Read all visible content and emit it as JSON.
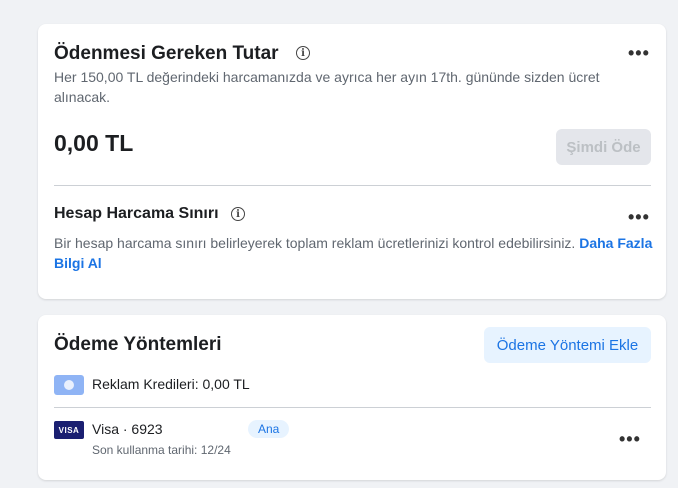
{
  "amount_due": {
    "title": "Ödenmesi Gereken Tutar",
    "description": "Her 150,00 TL değerindeki harcamanızda ve ayrıca her ayın 17th. gününde sizden ücret alınacak.",
    "amount": "0,00 TL",
    "pay_now_label": "Şimdi Öde"
  },
  "spending_limit": {
    "title": "Hesap Harcama Sınırı",
    "description": "Bir hesap harcama sınırı belirleyerek toplam reklam ücretlerinizi kontrol edebilirsiniz.",
    "learn_more": "Daha Fazla Bilgi Al"
  },
  "payment_methods": {
    "title": "Ödeme Yöntemleri",
    "add_label": "Ödeme Yöntemi Ekle",
    "ad_credits": "Reklam Kredileri: 0,00 TL",
    "card": {
      "brand_logo": "VISA",
      "name": "Visa · 6923",
      "badge": "Ana",
      "expiry": "Son kullanma tarihi: 12/24"
    }
  },
  "icons": {
    "info": "info-icon",
    "more": "more-dots-icon",
    "credit": "ad-credit-icon"
  },
  "colors": {
    "accent": "#1b74e4",
    "background": "#f0f2f5"
  }
}
